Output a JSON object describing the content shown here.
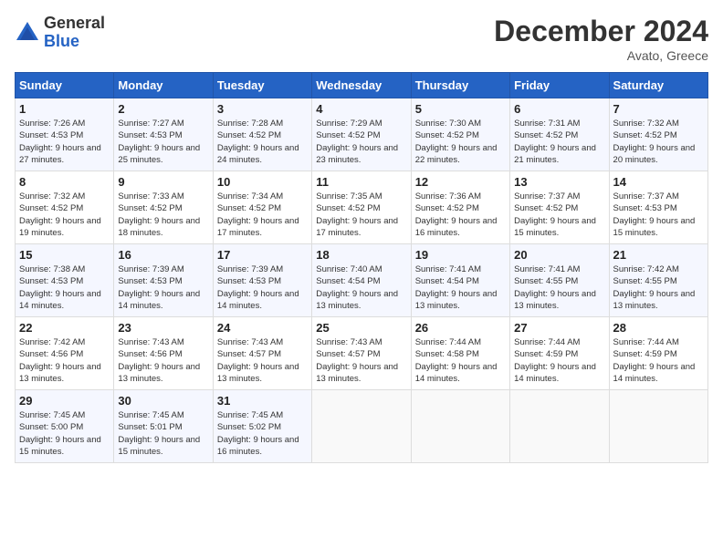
{
  "header": {
    "logo_general": "General",
    "logo_blue": "Blue",
    "month_year": "December 2024",
    "location": "Avato, Greece"
  },
  "days_of_week": [
    "Sunday",
    "Monday",
    "Tuesday",
    "Wednesday",
    "Thursday",
    "Friday",
    "Saturday"
  ],
  "weeks": [
    [
      {
        "day": "1",
        "sunrise": "Sunrise: 7:26 AM",
        "sunset": "Sunset: 4:53 PM",
        "daylight": "Daylight: 9 hours and 27 minutes."
      },
      {
        "day": "2",
        "sunrise": "Sunrise: 7:27 AM",
        "sunset": "Sunset: 4:53 PM",
        "daylight": "Daylight: 9 hours and 25 minutes."
      },
      {
        "day": "3",
        "sunrise": "Sunrise: 7:28 AM",
        "sunset": "Sunset: 4:52 PM",
        "daylight": "Daylight: 9 hours and 24 minutes."
      },
      {
        "day": "4",
        "sunrise": "Sunrise: 7:29 AM",
        "sunset": "Sunset: 4:52 PM",
        "daylight": "Daylight: 9 hours and 23 minutes."
      },
      {
        "day": "5",
        "sunrise": "Sunrise: 7:30 AM",
        "sunset": "Sunset: 4:52 PM",
        "daylight": "Daylight: 9 hours and 22 minutes."
      },
      {
        "day": "6",
        "sunrise": "Sunrise: 7:31 AM",
        "sunset": "Sunset: 4:52 PM",
        "daylight": "Daylight: 9 hours and 21 minutes."
      },
      {
        "day": "7",
        "sunrise": "Sunrise: 7:32 AM",
        "sunset": "Sunset: 4:52 PM",
        "daylight": "Daylight: 9 hours and 20 minutes."
      }
    ],
    [
      {
        "day": "8",
        "sunrise": "Sunrise: 7:32 AM",
        "sunset": "Sunset: 4:52 PM",
        "daylight": "Daylight: 9 hours and 19 minutes."
      },
      {
        "day": "9",
        "sunrise": "Sunrise: 7:33 AM",
        "sunset": "Sunset: 4:52 PM",
        "daylight": "Daylight: 9 hours and 18 minutes."
      },
      {
        "day": "10",
        "sunrise": "Sunrise: 7:34 AM",
        "sunset": "Sunset: 4:52 PM",
        "daylight": "Daylight: 9 hours and 17 minutes."
      },
      {
        "day": "11",
        "sunrise": "Sunrise: 7:35 AM",
        "sunset": "Sunset: 4:52 PM",
        "daylight": "Daylight: 9 hours and 17 minutes."
      },
      {
        "day": "12",
        "sunrise": "Sunrise: 7:36 AM",
        "sunset": "Sunset: 4:52 PM",
        "daylight": "Daylight: 9 hours and 16 minutes."
      },
      {
        "day": "13",
        "sunrise": "Sunrise: 7:37 AM",
        "sunset": "Sunset: 4:52 PM",
        "daylight": "Daylight: 9 hours and 15 minutes."
      },
      {
        "day": "14",
        "sunrise": "Sunrise: 7:37 AM",
        "sunset": "Sunset: 4:53 PM",
        "daylight": "Daylight: 9 hours and 15 minutes."
      }
    ],
    [
      {
        "day": "15",
        "sunrise": "Sunrise: 7:38 AM",
        "sunset": "Sunset: 4:53 PM",
        "daylight": "Daylight: 9 hours and 14 minutes."
      },
      {
        "day": "16",
        "sunrise": "Sunrise: 7:39 AM",
        "sunset": "Sunset: 4:53 PM",
        "daylight": "Daylight: 9 hours and 14 minutes."
      },
      {
        "day": "17",
        "sunrise": "Sunrise: 7:39 AM",
        "sunset": "Sunset: 4:53 PM",
        "daylight": "Daylight: 9 hours and 14 minutes."
      },
      {
        "day": "18",
        "sunrise": "Sunrise: 7:40 AM",
        "sunset": "Sunset: 4:54 PM",
        "daylight": "Daylight: 9 hours and 13 minutes."
      },
      {
        "day": "19",
        "sunrise": "Sunrise: 7:41 AM",
        "sunset": "Sunset: 4:54 PM",
        "daylight": "Daylight: 9 hours and 13 minutes."
      },
      {
        "day": "20",
        "sunrise": "Sunrise: 7:41 AM",
        "sunset": "Sunset: 4:55 PM",
        "daylight": "Daylight: 9 hours and 13 minutes."
      },
      {
        "day": "21",
        "sunrise": "Sunrise: 7:42 AM",
        "sunset": "Sunset: 4:55 PM",
        "daylight": "Daylight: 9 hours and 13 minutes."
      }
    ],
    [
      {
        "day": "22",
        "sunrise": "Sunrise: 7:42 AM",
        "sunset": "Sunset: 4:56 PM",
        "daylight": "Daylight: 9 hours and 13 minutes."
      },
      {
        "day": "23",
        "sunrise": "Sunrise: 7:43 AM",
        "sunset": "Sunset: 4:56 PM",
        "daylight": "Daylight: 9 hours and 13 minutes."
      },
      {
        "day": "24",
        "sunrise": "Sunrise: 7:43 AM",
        "sunset": "Sunset: 4:57 PM",
        "daylight": "Daylight: 9 hours and 13 minutes."
      },
      {
        "day": "25",
        "sunrise": "Sunrise: 7:43 AM",
        "sunset": "Sunset: 4:57 PM",
        "daylight": "Daylight: 9 hours and 13 minutes."
      },
      {
        "day": "26",
        "sunrise": "Sunrise: 7:44 AM",
        "sunset": "Sunset: 4:58 PM",
        "daylight": "Daylight: 9 hours and 14 minutes."
      },
      {
        "day": "27",
        "sunrise": "Sunrise: 7:44 AM",
        "sunset": "Sunset: 4:59 PM",
        "daylight": "Daylight: 9 hours and 14 minutes."
      },
      {
        "day": "28",
        "sunrise": "Sunrise: 7:44 AM",
        "sunset": "Sunset: 4:59 PM",
        "daylight": "Daylight: 9 hours and 14 minutes."
      }
    ],
    [
      {
        "day": "29",
        "sunrise": "Sunrise: 7:45 AM",
        "sunset": "Sunset: 5:00 PM",
        "daylight": "Daylight: 9 hours and 15 minutes."
      },
      {
        "day": "30",
        "sunrise": "Sunrise: 7:45 AM",
        "sunset": "Sunset: 5:01 PM",
        "daylight": "Daylight: 9 hours and 15 minutes."
      },
      {
        "day": "31",
        "sunrise": "Sunrise: 7:45 AM",
        "sunset": "Sunset: 5:02 PM",
        "daylight": "Daylight: 9 hours and 16 minutes."
      },
      null,
      null,
      null,
      null
    ]
  ]
}
